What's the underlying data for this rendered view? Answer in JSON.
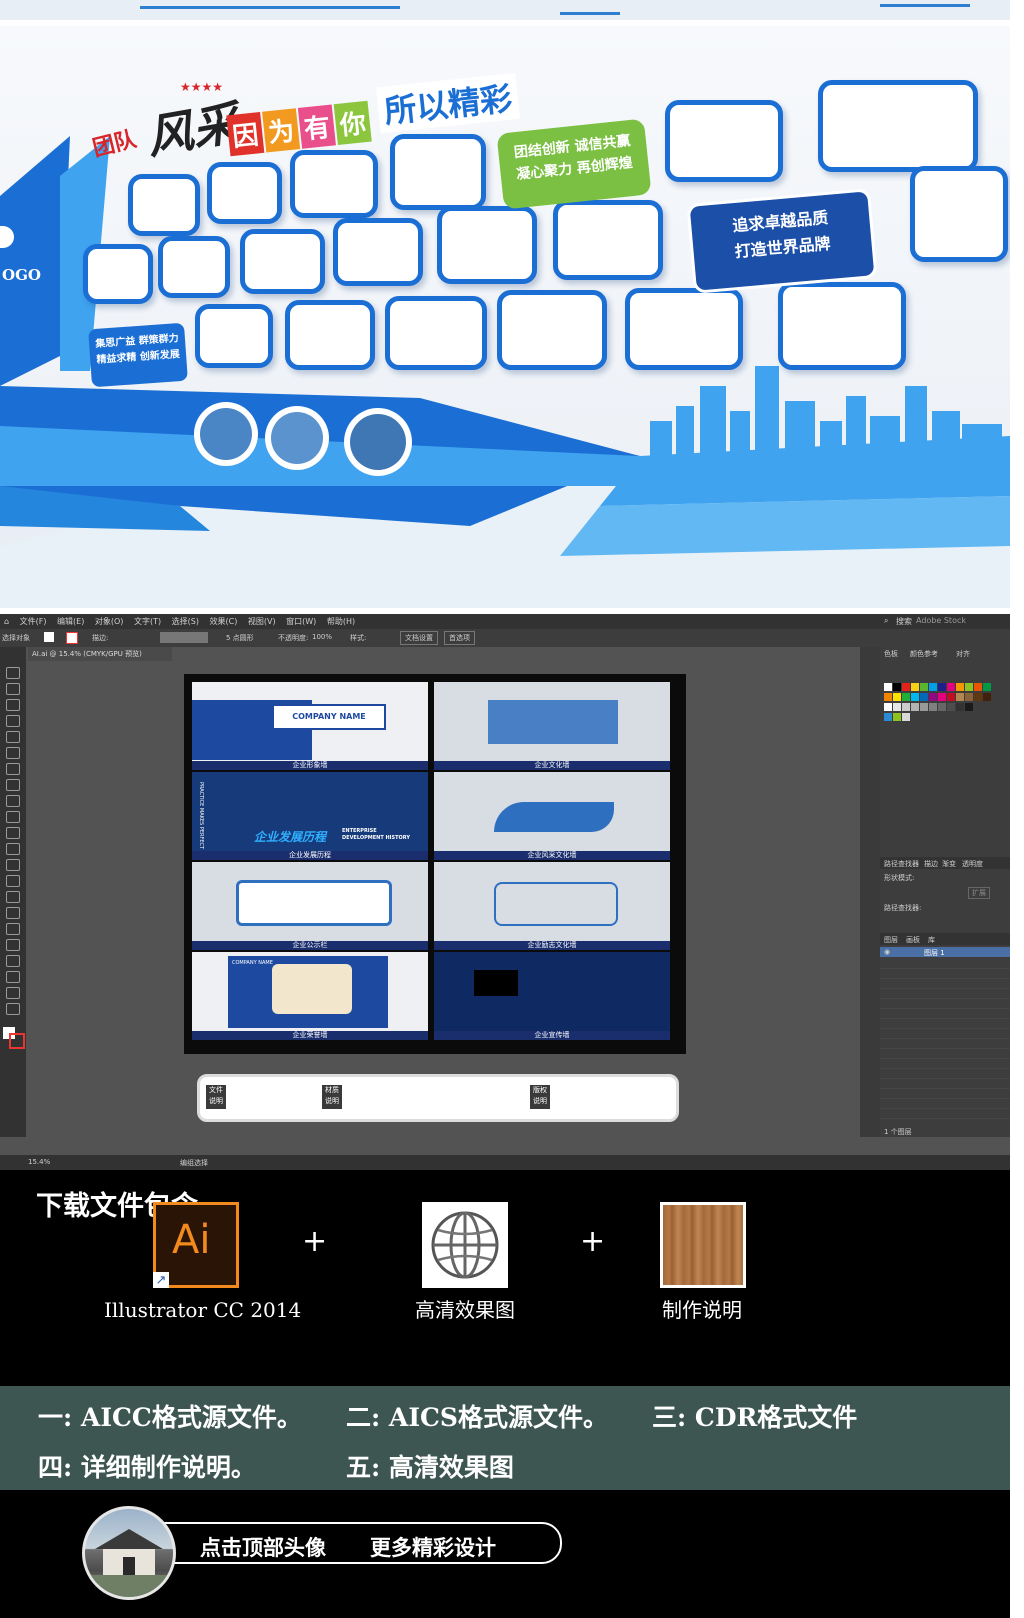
{
  "hero": {
    "title_part1": "团队",
    "title_part2": "风采",
    "title_chips": [
      "因",
      "为",
      "有",
      "你"
    ],
    "title_part3": "所以精彩",
    "green_panel": {
      "line1": "团结创新  诚信共赢",
      "line2": "凝心聚力  再创辉煌"
    },
    "blue_panel": {
      "line1": "追求卓越品质",
      "line2": "打造世界品牌"
    },
    "ship_panel": {
      "line1": "集思广益  群策群力",
      "line2": "精益求精  创新发展"
    },
    "logo_text": "OGO",
    "colors": {
      "primary": "#1b6fd4",
      "light": "#3fa3ef",
      "green": "#7bc043"
    }
  },
  "editor": {
    "menu": [
      "文件(F)",
      "编辑(E)",
      "对象(O)",
      "文字(T)",
      "选择(S)",
      "效果(C)",
      "视图(V)",
      "窗口(W)",
      "帮助(H)"
    ],
    "top_right": [
      "搜索",
      "Adobe Stock"
    ],
    "control": {
      "tool_label": "选择对象",
      "stroke_label": "描边:",
      "points": "5 点圆形",
      "opacity_label": "不透明度:",
      "opacity": "100%",
      "style_label": "样式:",
      "doc_setup": "文档设置",
      "prefs": "首选项"
    },
    "doc_tab": "AI.ai @ 15.4% (CMYK/GPU 预览)",
    "zoom": "15.4%",
    "status_text": "编组选择",
    "panel_tabs": [
      "色板",
      "颜色参考",
      "对齐"
    ],
    "pathfinder": {
      "tabs": [
        "路径查找器",
        "描边",
        "渐变",
        "透明度"
      ],
      "shape_modes": "形状模式:",
      "pathfinders": "路径查找器:",
      "expand": "扩展"
    },
    "layers": {
      "tabs": [
        "图层",
        "画板",
        "库"
      ],
      "layer_name": "图层 1",
      "count": "1 个图层"
    },
    "thumbs": [
      {
        "caption": "企业形象墙",
        "company": "COMPANY NAME"
      },
      {
        "caption": "企业文化墙"
      },
      {
        "caption": "企业发展历程",
        "heading": "企业发展历程",
        "heading_en_1": "ENTERPRISE",
        "heading_en_2": "DEVELOPMENT HISTORY",
        "side_text": "PRACTICE MAKES PERFECT"
      },
      {
        "caption": "企业风采文化墙"
      },
      {
        "caption": "企业公示栏"
      },
      {
        "caption": "企业励志文化墙"
      },
      {
        "caption": "企业荣誉墙",
        "company": "COMPANY NAME"
      },
      {
        "caption": "企业宣传墙"
      }
    ],
    "info_tags": [
      {
        "l1": "文件",
        "l2": "说明"
      },
      {
        "l1": "材质",
        "l2": "说明"
      },
      {
        "l1": "版权",
        "l2": "说明"
      }
    ]
  },
  "downloads": {
    "title": "下载文件包含:",
    "items": [
      {
        "icon": "adobe-illustrator-icon",
        "icon_text": "Ai",
        "label": "Illustrator CC 2014"
      },
      {
        "icon": "globe-icon",
        "label": "高清效果图"
      },
      {
        "icon": "wood-texture-icon",
        "label": "制作说明"
      }
    ],
    "plus": "+"
  },
  "formats": {
    "f1": "一: AICC格式源文件。",
    "f2": "二: AICS格式源文件。",
    "f3": "三: CDR格式文件",
    "f4": "四: 详细制作说明。",
    "f5": "五: 高清效果图"
  },
  "footer": {
    "cta_left": "点击顶部头像",
    "cta_right": "更多精彩设计"
  }
}
